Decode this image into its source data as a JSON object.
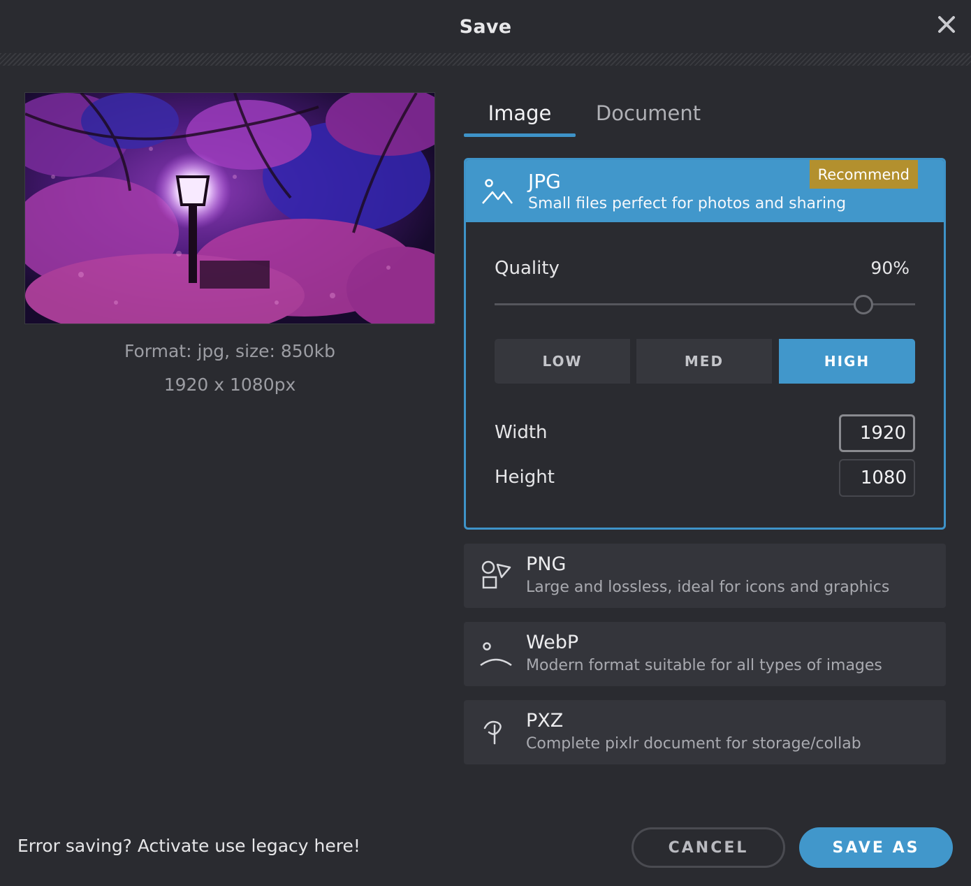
{
  "dialog": {
    "title": "Save"
  },
  "preview": {
    "format_line": "Format: jpg, size: 850kb",
    "dimensions_line": "1920 x 1080px"
  },
  "tabs": [
    {
      "label": "Image",
      "active": true
    },
    {
      "label": "Document",
      "active": false
    }
  ],
  "formats": {
    "jpg": {
      "name": "JPG",
      "description": "Small files perfect for photos and sharing",
      "badge": "Recommend",
      "icon": "mountain-icon",
      "quality_label": "Quality",
      "quality_value": "90%",
      "quality": 0.9,
      "presets": [
        "LOW",
        "MED",
        "HIGH"
      ],
      "selected_preset": "HIGH",
      "width_label": "Width",
      "width_value": "1920",
      "height_label": "Height",
      "height_value": "1080"
    },
    "png": {
      "name": "PNG",
      "description": "Large and lossless, ideal for icons and graphics",
      "icon": "shapes-icon"
    },
    "webp": {
      "name": "WebP",
      "description": "Modern format suitable for all types of images",
      "icon": "horizon-icon"
    },
    "pxz": {
      "name": "PXZ",
      "description": "Complete pixlr document for storage/collab",
      "icon": "pixlr-icon"
    }
  },
  "footer": {
    "legacy_link": "Error saving? Activate use legacy here!",
    "cancel_label": "CANCEL",
    "save_label": "SAVE AS"
  },
  "colors": {
    "accent": "#4197cb",
    "badge": "#b3902e",
    "background": "#2a2b30"
  }
}
